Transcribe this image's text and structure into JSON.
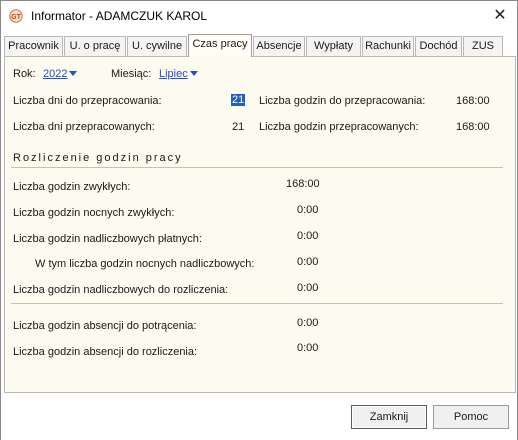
{
  "window": {
    "title": "Informator - ADAMCZUK KAROL"
  },
  "tabs": [
    {
      "label": "Pracownik"
    },
    {
      "label": "U. o pracę"
    },
    {
      "label": "U. cywilne"
    },
    {
      "label": "Czas pracy",
      "active": true
    },
    {
      "label": "Absencje"
    },
    {
      "label": "Wypłaty"
    },
    {
      "label": "Rachunki"
    },
    {
      "label": "Dochód"
    },
    {
      "label": "ZUS"
    }
  ],
  "filters": {
    "year_label": "Rok:",
    "year_value": "2022",
    "month_label": "Miesiąc:",
    "month_value": "Lipiec"
  },
  "summary": {
    "days_to_work_label": "Liczba dni do przepracowania:",
    "days_to_work_value": "21",
    "hours_to_work_label": "Liczba godzin do przepracowania:",
    "hours_to_work_value": "168:00",
    "days_worked_label": "Liczba dni przepracowanych:",
    "days_worked_value": "21",
    "hours_worked_label": "Liczba godzin przepracowanych:",
    "hours_worked_value": "168:00"
  },
  "settlement": {
    "title": "Rozliczenie godzin pracy",
    "rows": [
      {
        "label": "Liczba godzin zwykłych:",
        "value": "168:00"
      },
      {
        "label": "Liczba godzin nocnych zwykłych:",
        "value": "0:00"
      },
      {
        "label": "Liczba godzin nadliczbowych płatnych:",
        "value": "0:00"
      },
      {
        "label": "W tym liczba godzin nocnych nadliczbowych:",
        "value": "0:00"
      },
      {
        "label": "Liczba godzin nadliczbowych do rozliczenia:",
        "value": "0:00"
      }
    ]
  },
  "absence": {
    "rows": [
      {
        "label": "Liczba godzin absencji do potrącenia:",
        "value": "0:00"
      },
      {
        "label": "Liczba godzin absencji do rozliczenia:",
        "value": "0:00"
      }
    ]
  },
  "buttons": {
    "close_label": "Zamknij",
    "help_label": "Pomoc"
  },
  "colors": {
    "panel_background": "#fdfaf0",
    "link": "#1f4fd6",
    "selection": "#1f5fc9"
  }
}
